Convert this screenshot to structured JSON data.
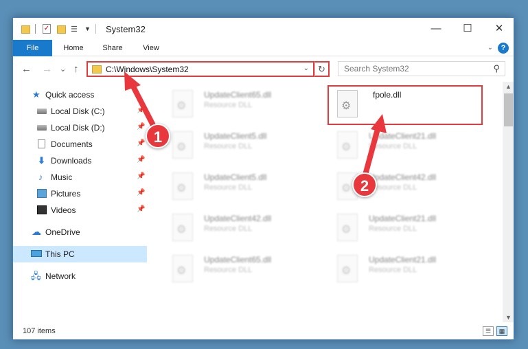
{
  "window": {
    "title": "System32",
    "minimize": "—",
    "maximize": "☐",
    "close": "✕"
  },
  "ribbon": {
    "tabs": [
      "File",
      "Home",
      "Share",
      "View"
    ],
    "help": "?"
  },
  "nav": {
    "back": "←",
    "forward": "→",
    "recent": "⌄",
    "up": "↑",
    "address": "C:\\Windows\\System32",
    "refresh": "↻",
    "search_placeholder": "Search System32"
  },
  "sidebar": {
    "items": [
      {
        "label": "Quick access",
        "icon": "star-icon",
        "pinned": false
      },
      {
        "label": "Local Disk (C:)",
        "icon": "disk-icon",
        "pinned": true
      },
      {
        "label": "Local Disk (D:)",
        "icon": "disk-icon",
        "pinned": true
      },
      {
        "label": "Documents",
        "icon": "documents-icon",
        "pinned": true
      },
      {
        "label": "Downloads",
        "icon": "download-icon",
        "pinned": true
      },
      {
        "label": "Music",
        "icon": "music-icon",
        "pinned": true
      },
      {
        "label": "Pictures",
        "icon": "pictures-icon",
        "pinned": true
      },
      {
        "label": "Videos",
        "icon": "video-icon",
        "pinned": true
      },
      {
        "label": "OneDrive",
        "icon": "cloud-icon",
        "pinned": false
      },
      {
        "label": "This PC",
        "icon": "pc-icon",
        "pinned": false,
        "selected": true
      },
      {
        "label": "Network",
        "icon": "network-icon",
        "pinned": false
      }
    ]
  },
  "files": {
    "left": [
      {
        "name": "UpdateClient65.dll",
        "type": "Resource DLL"
      },
      {
        "name": "UpdateClient5.dll",
        "type": "Resource DLL"
      },
      {
        "name": "UpdateClient5.dll",
        "type": "Resource DLL"
      },
      {
        "name": "UpdateClient42.dll",
        "type": "Resource DLL"
      },
      {
        "name": "UpdateClient65.dll",
        "type": "Resource DLL"
      }
    ],
    "right": [
      {
        "name": "fpole.dll",
        "type": ""
      },
      {
        "name": "UpdateClient21.dll",
        "type": "Resource DLL"
      },
      {
        "name": "UpdateClient42.dll",
        "type": "Resource DLL"
      },
      {
        "name": "UpdateClient21.dll",
        "type": "Resource DLL"
      },
      {
        "name": "UpdateClient21.dll",
        "type": "Resource DLL"
      }
    ]
  },
  "status": {
    "count": "107 items"
  },
  "annotations": {
    "badge1": "1",
    "badge2": "2",
    "color": "#e8383d"
  }
}
